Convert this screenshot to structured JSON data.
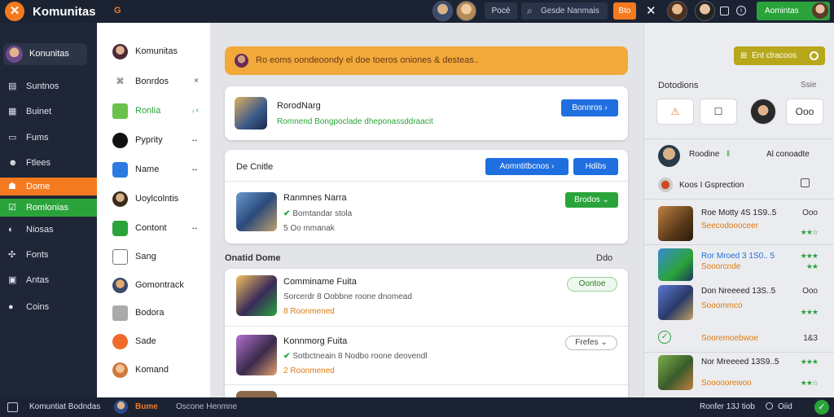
{
  "topbar": {
    "logo_glyph": "✕",
    "brand": "Komunitas",
    "brand_tag": "G",
    "pill": "Pocé",
    "search_text": "Gesde Nanmais",
    "orange_btn": "Bto",
    "close_glyph": "✕",
    "info_glyph": "i",
    "gear_glyph": "⚙",
    "green_btn": "Aomintas"
  },
  "leftnav": {
    "me_label": "Konunitas",
    "items": [
      {
        "icon": "▤",
        "label": "Suntnos"
      },
      {
        "icon": "▦",
        "label": "Buinet"
      },
      {
        "icon": "▭",
        "label": "Fums"
      },
      {
        "icon": "☻",
        "label": "Ftlees"
      },
      {
        "icon": "☗",
        "label": "Dome"
      },
      {
        "icon": "☑",
        "label": "Romlonias"
      },
      {
        "icon": "◐",
        "label": "Niosas"
      },
      {
        "icon": "✣",
        "label": "Fonts"
      },
      {
        "icon": "▣",
        "label": "Antas"
      },
      {
        "icon": "●",
        "label": "Coins"
      }
    ]
  },
  "panel2": {
    "items": [
      {
        "label": "Komunitas",
        "right": "",
        "color": "#4a2a3a"
      },
      {
        "label": "Bonrdos",
        "right": "×",
        "color": "#ffffff"
      },
      {
        "label": "Ronlia",
        "right": "ᵢ ‹",
        "color": "#6ac24a"
      },
      {
        "label": "Pyprity",
        "right": "↔",
        "color": "#111111"
      },
      {
        "label": "Name",
        "right": "↔",
        "color": "#2a7ae0"
      },
      {
        "label": "Uoylcolntis",
        "right": "",
        "color": "#7a5a3a"
      },
      {
        "label": "Contont",
        "right": "↔",
        "color": "#2aa33a"
      },
      {
        "label": "Sang",
        "right": "",
        "color": "#ffffff"
      },
      {
        "label": "Gomontrack",
        "right": "",
        "color": "#7a4a2a"
      },
      {
        "label": "Bodora",
        "right": "",
        "color": "#aaaaaa"
      },
      {
        "label": "Sade",
        "right": "",
        "color": "#f06a2a"
      },
      {
        "label": "Komand",
        "right": "",
        "color": "#d07a3a"
      }
    ]
  },
  "main": {
    "banner": "Ro eoms oondeoondy el doe toeros oniones & desteas..",
    "card1": {
      "title": "RorodNarg",
      "sub": "Romnend Bongpoclade dheponassddraacit",
      "button": "Bonnros  ›"
    },
    "card2": {
      "heading": "De Cnitle",
      "btn_a": "Aomntitbcnos  ›",
      "btn_b": "Hdibs",
      "item_title": "Ranmnes Narra",
      "item_sub": "Bomtandar stola",
      "item_meta": "5 Oo mmanak",
      "item_button": "Brodos  ⌄"
    },
    "section_label": "Onatid Dome",
    "section_right": "Ddo",
    "list": [
      {
        "title": "Comminame Fuita",
        "sub": "Sorcerdr  8 Oobbne  roone  dnomead",
        "meta": "8 Roonmened",
        "button": "Oontoe"
      },
      {
        "title": "Konnmorg Fuita",
        "sub": "Sotbctneain  8 Nodbo  roone  deovendl",
        "meta": "2 Roonmened",
        "button": "Frefes  ⌄"
      },
      {
        "title": "",
        "sub": "",
        "meta": "",
        "button": ""
      }
    ]
  },
  "right": {
    "top_btn": "Ent clracoos",
    "heading": "Dotodions",
    "heading_right": "Ssie",
    "tiles": [
      "⚠",
      "☐",
      "",
      "Ooo"
    ],
    "profile_name": "Roodine",
    "profile_mark": "ǁ",
    "profile_right": "Al conoadte",
    "note": "Koos  I Gsprection",
    "items": [
      {
        "title": "Roe Motty 4S 1S9..5",
        "sub": "Seecodoooceer",
        "right_top": "Ooo",
        "right_bottom": "★★☆"
      },
      {
        "title": "Ror Mroed 3 1S0.. 5",
        "sub": "Sooorcnde",
        "right_top": "★★★",
        "right_bottom": "★★"
      },
      {
        "title": "Don Nreeeed 13S..5",
        "sub": "Sooommco",
        "right_top": "Ooo",
        "right_bottom": "★★★"
      },
      {
        "title": "Sooremoebwoe",
        "sub": "",
        "right_top": "",
        "right_bottom": "1&3"
      },
      {
        "title": "Nor Mreeeed 13S9..5",
        "sub": "Sooooorewoo",
        "right_top": "★★★",
        "right_bottom": "★★☆"
      }
    ]
  },
  "bottombar": {
    "left": "Komuntiat  Bodndas",
    "mid_brand": "Bume",
    "mid_text": "Oscone Henmne",
    "right_text": "Ronfer  13J tiob",
    "right_label": "Oiid"
  }
}
